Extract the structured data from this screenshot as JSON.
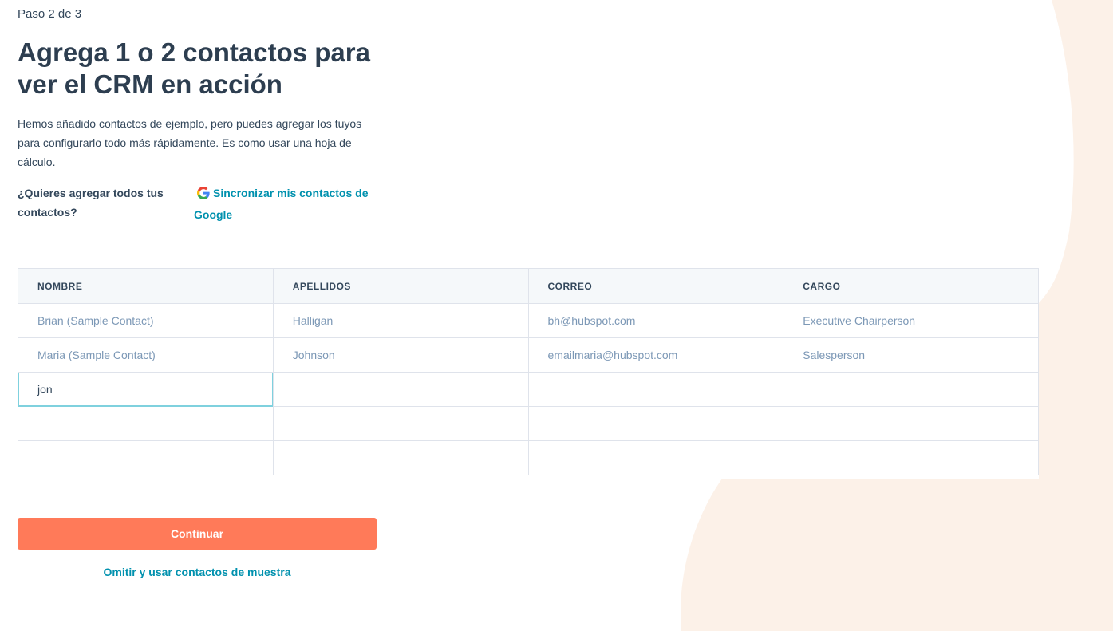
{
  "step_indicator": "Paso 2 de 3",
  "title": "Agrega 1 o 2 contactos para ver el CRM en acción",
  "description": "Hemos añadido contactos de ejemplo, pero puedes agregar los tuyos para configurarlo todo más rápidamente. Es como usar una hoja de cálculo.",
  "sync": {
    "question": "¿Quieres agregar todos tus contactos?",
    "link_label": "Sincronizar mis contactos de Google",
    "icon": "google-icon"
  },
  "table": {
    "headers": [
      "NOMBRE",
      "APELLIDOS",
      "CORREO",
      "CARGO"
    ],
    "rows": [
      [
        "Brian (Sample Contact)",
        "Halligan",
        "bh@hubspot.com",
        "Executive Chairperson"
      ],
      [
        "Maria (Sample Contact)",
        "Johnson",
        "emailmaria@hubspot.com",
        "Salesperson"
      ],
      [
        "jon",
        "",
        "",
        ""
      ],
      [
        "",
        "",
        "",
        ""
      ],
      [
        "",
        "",
        "",
        ""
      ]
    ]
  },
  "buttons": {
    "continue_label": "Continuar",
    "skip_label": "Omitir y usar contactos de muestra"
  },
  "colors": {
    "accent": "#ff7a59",
    "link": "#0091ae",
    "heading": "#2d3e50",
    "background_shape": "#fcf1e8"
  }
}
